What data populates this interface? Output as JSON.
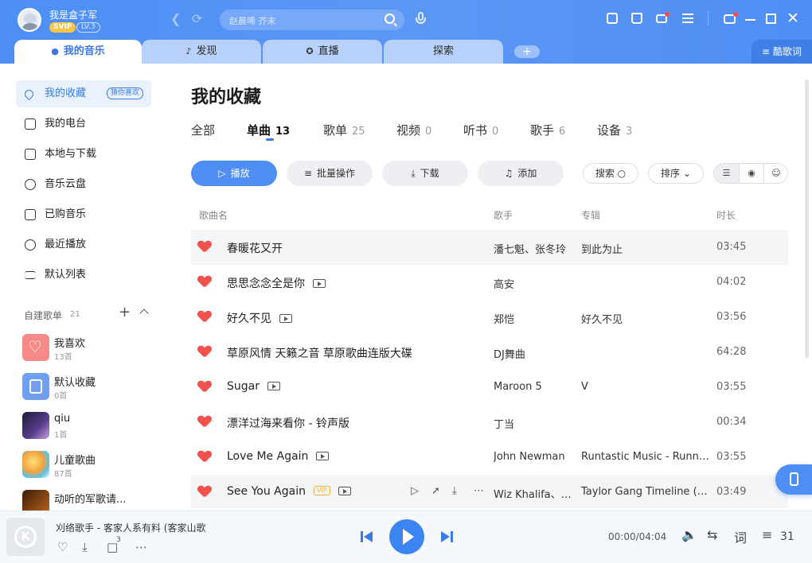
{
  "user": {
    "name": "我是盒子军",
    "svip": "SVIP",
    "level": "LV.3"
  },
  "search": {
    "placeholder": "赵晨唏 芥末"
  },
  "tabs": [
    {
      "label": "我的音乐",
      "icon": "person-icon"
    },
    {
      "label": "发现",
      "icon": "music-note-icon"
    },
    {
      "label": "直播",
      "icon": "live-icon"
    },
    {
      "label": "探索",
      "icon": ""
    }
  ],
  "lyrics_button": "酷歌词",
  "sidebar": {
    "items": [
      {
        "label": "我的收藏",
        "badge": "猜你喜欢"
      },
      {
        "label": "我的电台"
      },
      {
        "label": "本地与下载"
      },
      {
        "label": "音乐云盘"
      },
      {
        "label": "已购音乐"
      },
      {
        "label": "最近播放"
      },
      {
        "label": "默认列表"
      }
    ],
    "section": {
      "title": "自建歌单",
      "count": "21"
    },
    "playlists": [
      {
        "name": "我喜欢",
        "count": "13首",
        "color": "#f58a86"
      },
      {
        "name": "默认收藏",
        "count": "0首",
        "color": "#6f9ff2"
      },
      {
        "name": "qiu",
        "count": "1首",
        "color": "#2a2550"
      },
      {
        "name": "儿童歌曲",
        "count": "87首",
        "color": "#f6c34a"
      },
      {
        "name": "动听的军歌请...",
        "count": "",
        "color": "#7a4a20"
      }
    ]
  },
  "main": {
    "title": "我的收藏",
    "subtabs": [
      {
        "label": "全部",
        "count": ""
      },
      {
        "label": "单曲",
        "count": "13"
      },
      {
        "label": "歌单",
        "count": "25"
      },
      {
        "label": "视频",
        "count": "0"
      },
      {
        "label": "听书",
        "count": "0"
      },
      {
        "label": "歌手",
        "count": "6"
      },
      {
        "label": "设备",
        "count": "3"
      }
    ],
    "actions": {
      "play": "播放",
      "batch": "批量操作",
      "download": "下载",
      "add": "添加",
      "search": "搜索",
      "sort": "排序"
    },
    "columns": {
      "title": "歌曲名",
      "artist": "歌手",
      "album": "专辑",
      "duration": "时长"
    },
    "songs": [
      {
        "title": "春暖花又开",
        "artist": "潘七魁、张冬玲",
        "album": "到此为止",
        "duration": "03:45"
      },
      {
        "title": "思思念念全是你",
        "artist": "高安",
        "album": "",
        "duration": "04:02"
      },
      {
        "title": "好久不见",
        "artist": "郑恺",
        "album": "好久不见",
        "duration": "03:56"
      },
      {
        "title": "草原风情 天籁之音 草原歌曲连版大碟",
        "artist": "DJ舞曲",
        "album": "",
        "duration": "64:28"
      },
      {
        "title": "Sugar",
        "artist": "Maroon 5",
        "album": "V",
        "duration": "03:55"
      },
      {
        "title": "漂洋过海来看你 - 铃声版",
        "artist": "丁当",
        "album": "",
        "duration": "00:34"
      },
      {
        "title": "Love Me Again",
        "artist": "John Newman",
        "album": "Runtastic Music - Runni...",
        "duration": "03:55"
      },
      {
        "title": "See You Again",
        "artist": "Wiz Khalifa、C...",
        "album": "Taylor Gang Timeline (Mi...",
        "duration": "03:49",
        "vip": "VIP"
      }
    ]
  },
  "player": {
    "title": "刈络歌手 - 客家人系有料 (客家山歌",
    "time": "00:00/04:04",
    "lyrics": "词",
    "queue_count": "31",
    "cover_letter": "K",
    "comment_count": "3"
  },
  "colors": {
    "accent": "#4d8ff5",
    "heart": "#f2524d"
  }
}
